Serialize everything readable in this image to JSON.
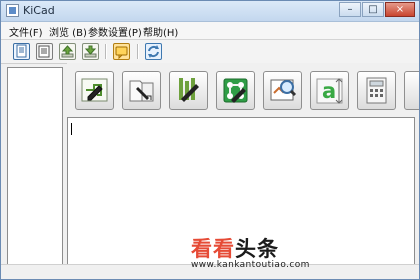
{
  "window": {
    "title": "KiCad"
  },
  "menu": [
    {
      "label": "文件(F)"
    },
    {
      "label": "浏览 (B)"
    },
    {
      "label": "参数设置(P)"
    },
    {
      "label": "帮助(H)"
    }
  ],
  "toolbar_icons": [
    "new-project-icon",
    "open-project-icon",
    "upload-icon",
    "download-icon",
    "comment-icon",
    "refresh-icon"
  ],
  "tool_icons": [
    "schematic-editor-icon",
    "library-editor-icon",
    "component-association-icon",
    "pcb-editor-icon",
    "gerber-viewer-icon",
    "bitmap-converter-icon",
    "calculator-icon",
    "partial-tool-icon"
  ],
  "watermark": {
    "main_1": "看看",
    "main_2": "头条",
    "url": "www.kankantoutiao.com"
  }
}
